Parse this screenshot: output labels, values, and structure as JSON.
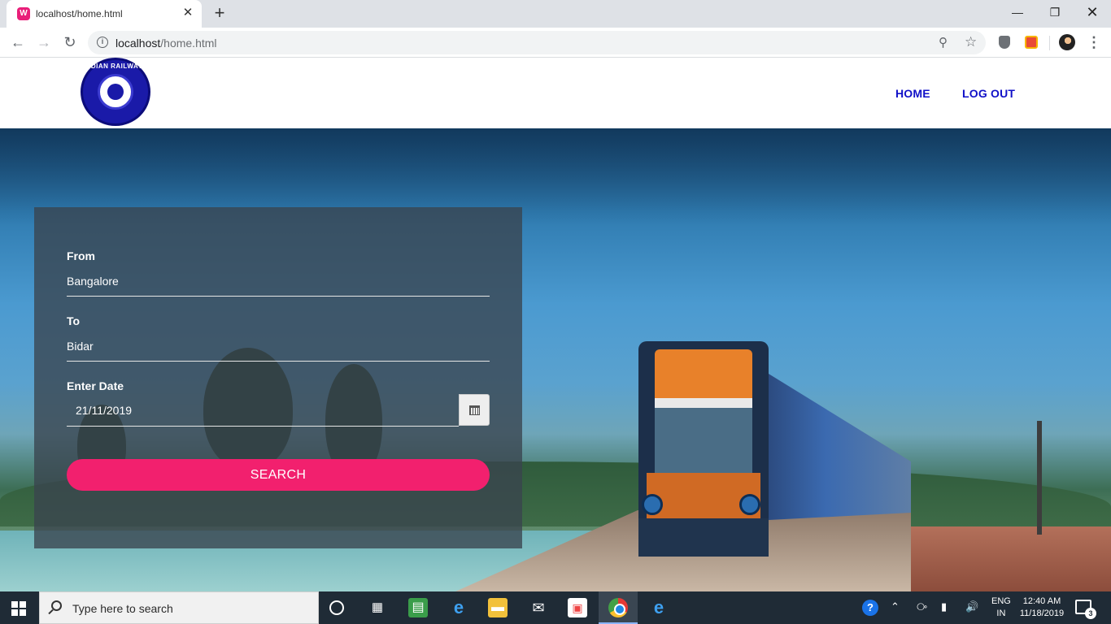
{
  "browser": {
    "tab_title": "localhost/home.html",
    "url_host": "localhost",
    "url_path": "/home.html",
    "new_tab_glyph": "+",
    "close_tab_glyph": "✕",
    "window_controls": {
      "minimize": "—",
      "maximize": "❐",
      "close": "✕"
    }
  },
  "site": {
    "logo_text": "INDIAN RAILWAYS",
    "nav": {
      "home": "HOME",
      "logout": "LOG OUT"
    }
  },
  "search_form": {
    "from_label": "From",
    "from_value": "Bangalore",
    "to_label": "To",
    "to_value": "Bidar",
    "date_label": "Enter Date",
    "date_value": "21/11/2019",
    "search_button": "SEARCH"
  },
  "taskbar": {
    "search_placeholder": "Type here to search",
    "language_line1": "ENG",
    "language_line2": "IN",
    "time": "12:40 AM",
    "date": "11/18/2019",
    "notification_count": "3"
  },
  "colors": {
    "accent": "#f2206e",
    "nav_link": "#1010c8",
    "panel_bg": "rgba(58,68,78,0.78)",
    "taskbar_bg": "#1f2b36"
  },
  "icons": {
    "browser": [
      "back-icon",
      "forward-icon",
      "reload-icon",
      "info-icon",
      "key-icon",
      "star-icon",
      "extension-icon",
      "profile-icon",
      "menu-icon"
    ],
    "taskbar": [
      "windows-start-icon",
      "search-icon",
      "cortana-icon",
      "task-view-icon",
      "edge-icon",
      "file-explorer-icon",
      "mail-icon",
      "store-icon",
      "chrome-icon",
      "internet-explorer-icon"
    ]
  }
}
